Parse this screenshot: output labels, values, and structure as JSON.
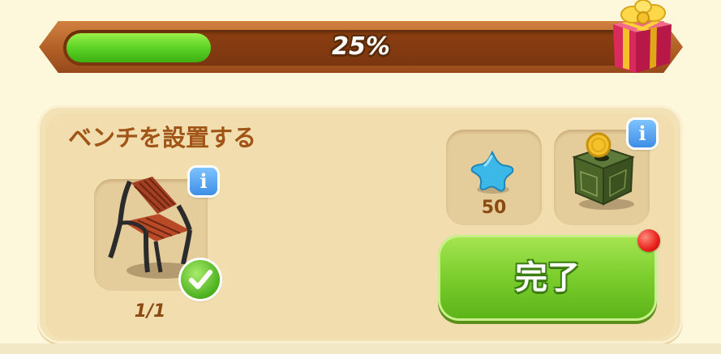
{
  "progress": {
    "label": "25%",
    "fraction": 0.25
  },
  "quest": {
    "title": "ベンチを設置する",
    "item": {
      "icon": "bench-icon",
      "count": "1/1",
      "completed": true
    }
  },
  "rewards": [
    {
      "icon": "blue-star-icon",
      "amount": "50"
    },
    {
      "icon": "green-coin-box-icon",
      "amount": ""
    }
  ],
  "actions": {
    "complete_label": "完了"
  },
  "colors": {
    "progress_fill": "#5cd326",
    "frame": "#b15f26",
    "title_text": "#a05416",
    "complete_button": "#7acd2c",
    "info_button": "#3d8ee6",
    "notification_dot": "#e8201a"
  }
}
